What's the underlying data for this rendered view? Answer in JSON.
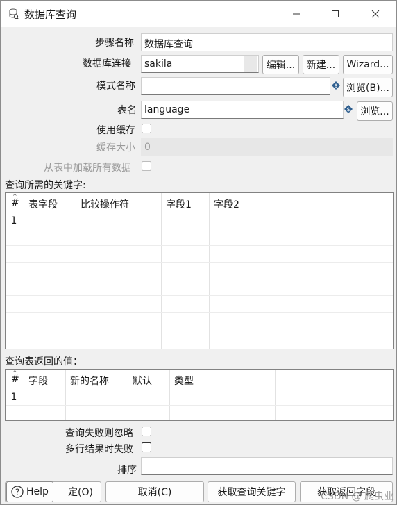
{
  "window": {
    "title": "数据库查询"
  },
  "form": {
    "step_name_label": "步骤名称",
    "step_name_value": "数据库查询",
    "connection_label": "数据库连接",
    "connection_value": "sakila",
    "edit_label": "编辑...",
    "new_label": "新建...",
    "wizard_label": "Wizard...",
    "schema_label": "模式名称",
    "schema_value": "",
    "browse_schema_label": "浏览(B)...",
    "table_label": "表名",
    "table_value": "language",
    "browse_table_label": "浏览...",
    "use_cache_label": "使用缓存",
    "cache_size_label": "缓存大小",
    "cache_size_value": "0",
    "load_all_label": "从表中加载所有数据"
  },
  "keys_section": {
    "title": "查询所需的关键字:",
    "columns": [
      "#",
      "表字段",
      "比较操作符",
      "字段1",
      "字段2"
    ],
    "rows": [
      [
        "1",
        "",
        "",
        "",
        ""
      ]
    ]
  },
  "return_section": {
    "title": "查询表返回的值：",
    "columns": [
      "#",
      "字段",
      "新的名称",
      "默认",
      "类型"
    ],
    "rows": [
      [
        "1",
        "",
        "",
        "",
        ""
      ]
    ]
  },
  "options": {
    "fail_ignore_label": "查询失败则忽略",
    "multi_fail_label": "多行结果时失败",
    "order_label": "排序",
    "order_value": ""
  },
  "footer": {
    "help_label": "Help",
    "ok_label": "定(O)",
    "cancel_label": "取消(C)",
    "get_keys_label": "获取查询关键字",
    "get_fields_label": "获取返回字段"
  },
  "watermark": "CSDN @ 爬虫业"
}
